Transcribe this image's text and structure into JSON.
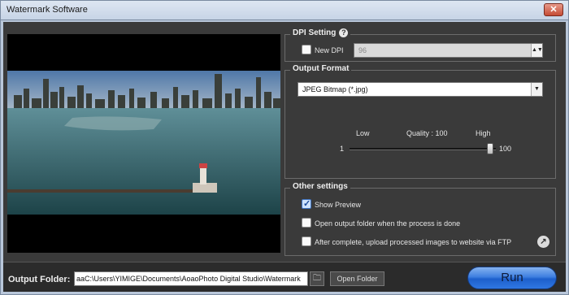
{
  "window": {
    "title": "Watermark Software",
    "close_label": "✕"
  },
  "dpi_setting": {
    "title": "DPI Setting",
    "new_dpi_label": "New DPI",
    "new_dpi_checked": false,
    "dpi_value": "96"
  },
  "output_format": {
    "title": "Output Format",
    "selected": "JPEG Bitmap (*.jpg)",
    "quality": {
      "low_label": "Low",
      "high_label": "High",
      "quality_label": "Quality : 100",
      "min": "1",
      "max": "100",
      "value": 100
    }
  },
  "other_settings": {
    "title": "Other settings",
    "show_preview_label": "Show Preview",
    "show_preview_checked": true,
    "open_output_label": "Open output folder when the process is done",
    "open_output_checked": false,
    "upload_ftp_label": "After complete, upload processed images to website via FTP",
    "upload_ftp_checked": false
  },
  "bottom": {
    "output_folder_label": "Output Folder:",
    "output_folder_value": "aaC:\\Users\\YIMIGE\\Documents\\AoaoPhoto Digital Studio\\Watermark",
    "open_folder_label": "Open Folder",
    "run_label": "Run"
  },
  "colors": {
    "accent": "#2f77e2",
    "panel": "#3a3a3a"
  }
}
